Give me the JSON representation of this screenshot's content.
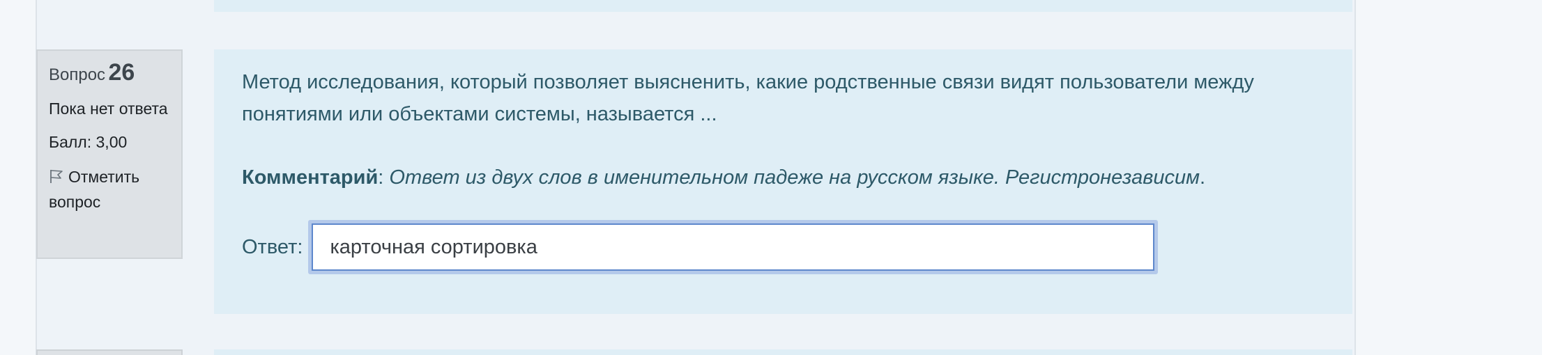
{
  "question": {
    "label": "Вопрос",
    "number": "26",
    "state": "Пока нет ответа",
    "grade": "Балл: 3,00",
    "flag_label": "Отметить вопрос",
    "text": "Метод исследования, который позволяет выясненить, какие родственные связи видят пользователи между понятиями или объектами системы, называется ...",
    "comment_label": "Комментарий",
    "comment_sep": ":",
    "comment_text": "Ответ из двух слов в именительном падеже на русском языке. Регистронезависим",
    "comment_end": ".",
    "answer_label": "Ответ:",
    "answer_value": "карточная сортировка"
  },
  "icons": {
    "flag": "flag-icon"
  },
  "colors": {
    "info_bg": "#dee2e6",
    "formulation_bg": "#dfeef6",
    "text": "#2d5968",
    "focus_ring": "#b4c9ea"
  }
}
